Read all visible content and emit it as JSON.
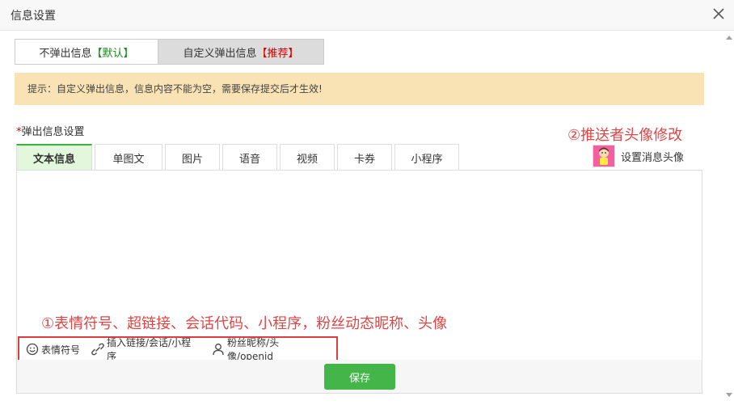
{
  "dialog": {
    "title": "信息设置"
  },
  "mode_toggle": {
    "off_label": "不弹出信息",
    "off_tag": "【默认】",
    "custom_label": "自定义弹出信息",
    "custom_tag": "【推荐】"
  },
  "tip": "提示：自定义弹出信息，信息内容不能为空，需要保存提交后才生效!",
  "field": {
    "required_mark": "*",
    "label": "弹出信息设置"
  },
  "tabs": [
    {
      "label": "文本信息",
      "active": true
    },
    {
      "label": "单图文"
    },
    {
      "label": "图片"
    },
    {
      "label": "语音"
    },
    {
      "label": "视频"
    },
    {
      "label": "卡券"
    },
    {
      "label": "小程序"
    }
  ],
  "avatar": {
    "label": "设置消息头像"
  },
  "annotations": {
    "note1": "①表情符号、超链接、会话代码、小程序，粉丝动态昵称、头像",
    "note2": "②推送者头像修改"
  },
  "toolbar": {
    "emoji": "表情符号",
    "link": "插入链接/会话/小程序",
    "fans": "粉丝昵称/头像/openid"
  },
  "save_label": "保存",
  "colors": {
    "accent_green": "#44b549",
    "annotation_red": "#e04545",
    "tip_bg": "#f9e3b4"
  }
}
